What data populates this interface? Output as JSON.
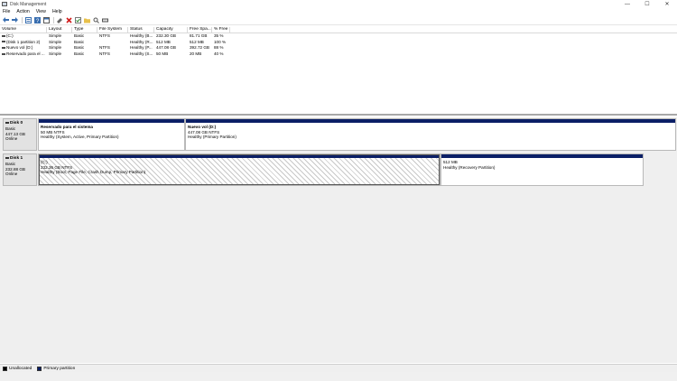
{
  "window": {
    "title": "Disk Management",
    "controls": [
      "—",
      "☐",
      "✕"
    ]
  },
  "menu": [
    "File",
    "Action",
    "View",
    "Help"
  ],
  "toolbar": {
    "icons": [
      "back-icon",
      "forward-icon",
      "properties-icon",
      "help-icon",
      "console-icon",
      "connect-icon",
      "delete-icon",
      "checklist-icon",
      "folder-icon",
      "search-icon",
      "disk-icon"
    ]
  },
  "volume_list": {
    "headers": [
      "Volume",
      "Layout",
      "Type",
      "File System",
      "Status",
      "Capacity",
      "Free Spa...",
      "% Free"
    ],
    "rows": [
      {
        "volume": "(C:)",
        "layout": "Simple",
        "type": "Basic",
        "fs": "NTFS",
        "status": "Healthy (B...",
        "capacity": "232.30 GB",
        "free": "81.71 GB",
        "pct": "35 %"
      },
      {
        "volume": "(Disk 1 partition 2)",
        "layout": "Simple",
        "type": "Basic",
        "fs": "",
        "status": "Healthy (R...",
        "capacity": "512 MB",
        "free": "512 MB",
        "pct": "100 %"
      },
      {
        "volume": "Nuevo vol (D:)",
        "layout": "Simple",
        "type": "Basic",
        "fs": "NTFS",
        "status": "Healthy (P...",
        "capacity": "447.08 GB",
        "free": "392.72 GB",
        "pct": "88 %"
      },
      {
        "volume": "Reservado para el ...",
        "layout": "Simple",
        "type": "Basic",
        "fs": "NTFS",
        "status": "Healthy (S...",
        "capacity": "50 MB",
        "free": "20 MB",
        "pct": "40 %"
      }
    ]
  },
  "disks": [
    {
      "name": "Disk 0",
      "type": "Basic",
      "size": "447.13 GB",
      "state": "Online",
      "partitions": [
        {
          "name": "Reservado para el sistema",
          "size": "50 MB NTFS",
          "status": "Healthy (System, Active, Primary Partition)"
        },
        {
          "name": "Nuevo vol (D:)",
          "size": "447.08 GB NTFS",
          "status": "Healthy (Primary Partition)"
        }
      ]
    },
    {
      "name": "Disk 1",
      "type": "Basic",
      "size": "232.88 GB",
      "state": "Online",
      "partitions": [
        {
          "name": "(C:)",
          "size": "232.36 GB NTFS",
          "status": "Healthy (Boot, Page File, Crash Dump, Primary Partition)"
        },
        {
          "name": "",
          "size": "512 MB",
          "status": "Healthy (Recovery Partition)"
        }
      ]
    }
  ],
  "legend": {
    "items": [
      {
        "label": "Unallocated",
        "color": "#000000"
      },
      {
        "label": "Primary partition",
        "color": "#0b1f66"
      }
    ]
  }
}
